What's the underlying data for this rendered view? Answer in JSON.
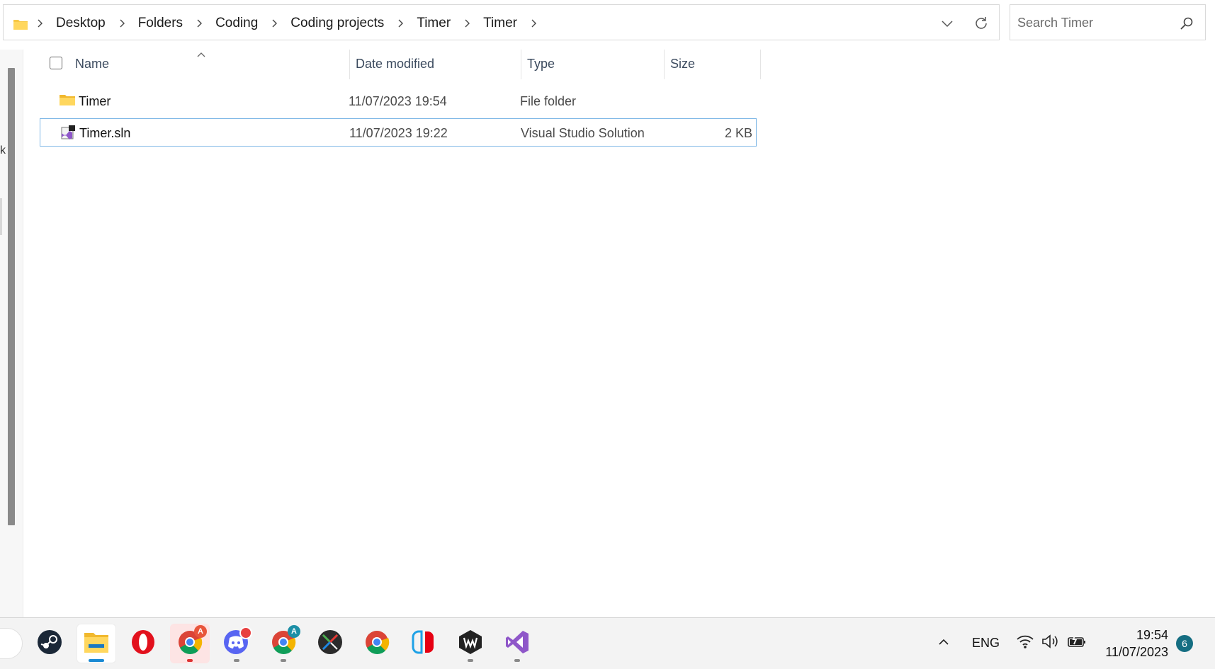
{
  "address": {
    "breadcrumbs": [
      "Desktop",
      "Folders",
      "Coding",
      "Coding projects",
      "Timer",
      "Timer"
    ]
  },
  "search": {
    "placeholder": "Search Timer"
  },
  "columns": {
    "name": "Name",
    "date": "Date modified",
    "type": "Type",
    "size": "Size"
  },
  "files": [
    {
      "name": "Timer",
      "date": "11/07/2023 19:54",
      "type": "File folder",
      "size": "",
      "icon": "folder-icon"
    },
    {
      "name": "Timer.sln",
      "date": "11/07/2023 19:22",
      "type": "Visual Studio Solution",
      "size": "2 KB",
      "icon": "visual-studio-solution-icon"
    }
  ],
  "taskbar": {
    "apps": [
      "Steam",
      "File Explorer",
      "Opera",
      "Chrome",
      "Discord",
      "Chrome",
      "Unity",
      "Chrome",
      "Nintendo Switch",
      "Wwise",
      "Visual Studio"
    ],
    "badges": {
      "chrome_1": "A",
      "chrome_2": "A"
    }
  },
  "tray": {
    "language": "ENG",
    "time": "19:54",
    "date": "11/07/2023",
    "notifications": "6"
  },
  "nav": {
    "stub": "k"
  },
  "colors": {
    "selection_border": "#7fb8e6",
    "folder": "#f7c844",
    "vs_purple": "#8f57c9",
    "notif_badge": "#156e82"
  }
}
